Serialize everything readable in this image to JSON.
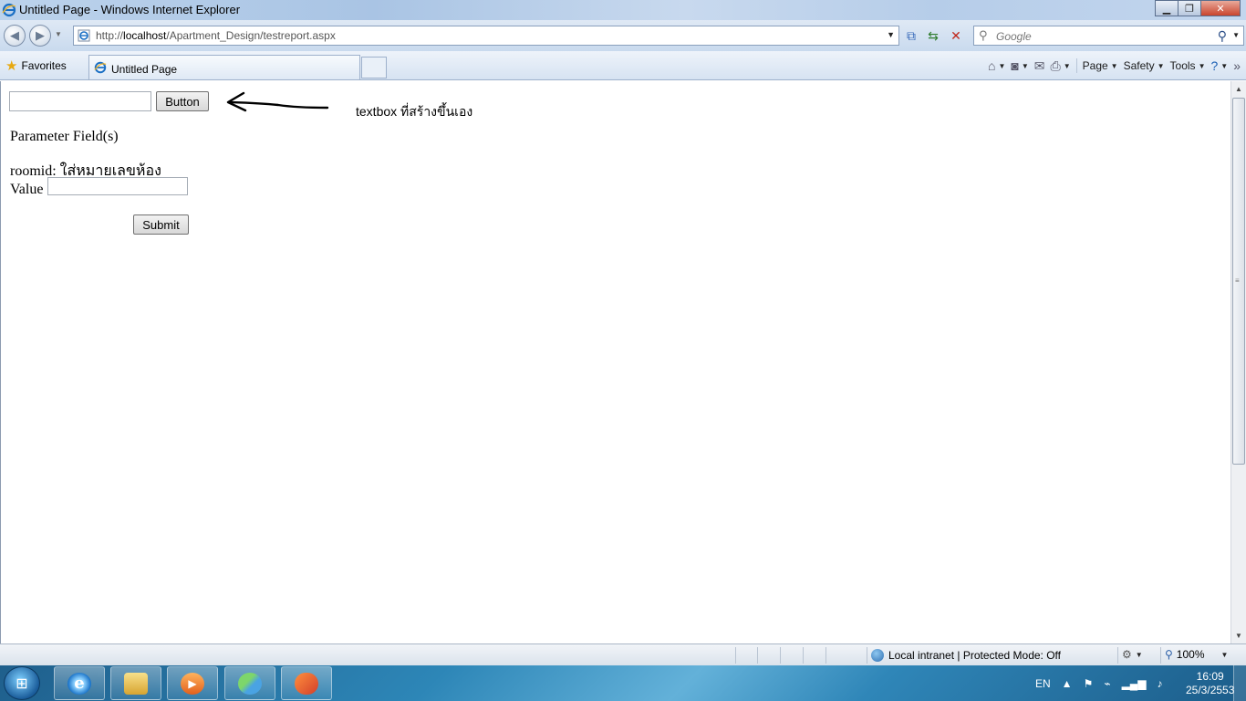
{
  "window": {
    "title": "Untitled Page - Windows Internet Explorer"
  },
  "address_bar": {
    "url_prefix": "http://",
    "url_host": "localhost",
    "url_path": "/Apartment_Design/testreport.aspx"
  },
  "search": {
    "placeholder": "Google"
  },
  "favorites_bar": {
    "favorites_label": "Favorites",
    "tab_label": "Untitled Page"
  },
  "command_bar": {
    "page_label": "Page",
    "safety_label": "Safety",
    "tools_label": "Tools"
  },
  "content": {
    "button_label": "Button",
    "annotation": "textbox ที่สร้างขึ้นเอง",
    "parameter_title": "Parameter Field(s)",
    "roomid_label": "roomid: ใส่หมายเลขห้อง",
    "value_label": "Value",
    "submit_label": "Submit"
  },
  "status_bar": {
    "zone_text": "Local intranet | Protected Mode: Off",
    "zoom_level": "100%"
  },
  "taskbar": {
    "language": "EN",
    "time": "16:09",
    "date": "25/3/2553"
  }
}
